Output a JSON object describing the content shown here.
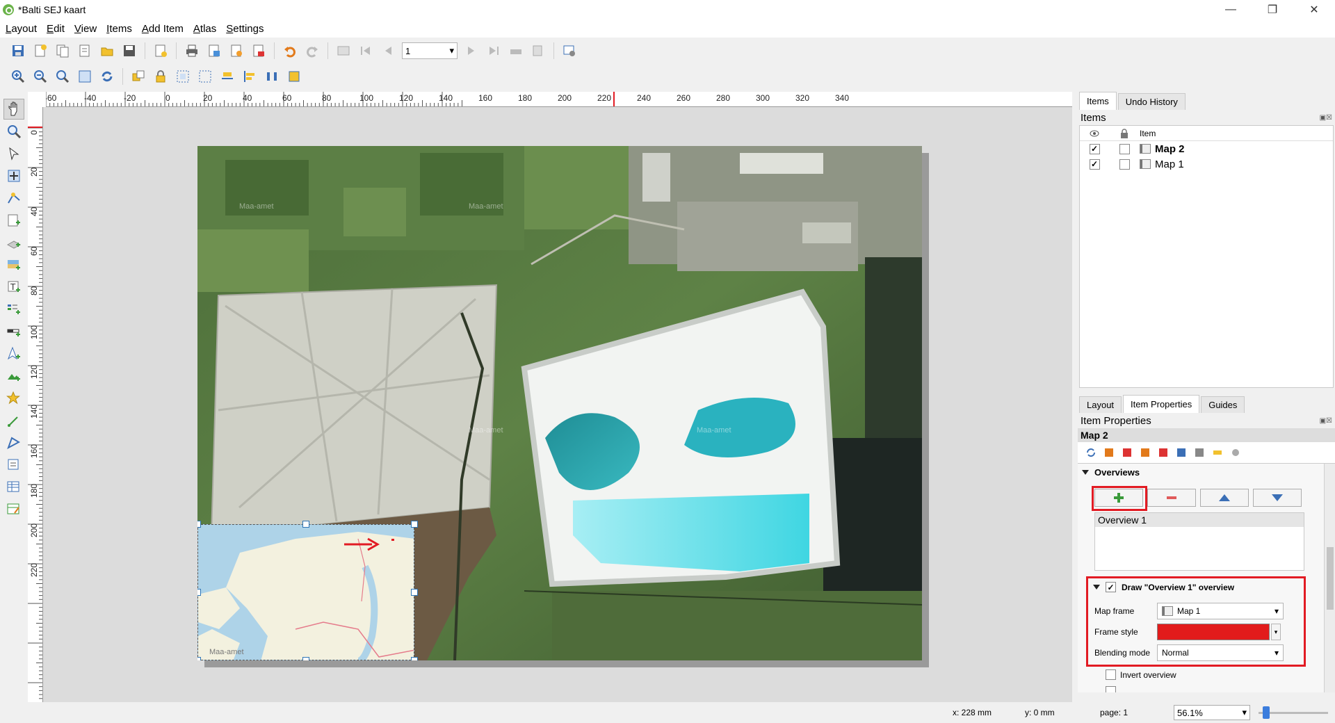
{
  "window": {
    "title": "*Balti SEJ kaart"
  },
  "menu": [
    "Layout",
    "Edit",
    "View",
    "Items",
    "Add Item",
    "Atlas",
    "Settings"
  ],
  "toolbar": {
    "page_value": "1"
  },
  "rulers": {
    "h_labels": [
      "-60",
      "-40",
      "-20",
      "0",
      "20",
      "40",
      "60",
      "80",
      "100",
      "120",
      "140",
      "160",
      "180",
      "200",
      "220",
      "240",
      "260",
      "280",
      "300",
      "320",
      "340"
    ],
    "v_labels": [
      "0",
      "20",
      "40",
      "60",
      "80",
      "100",
      "120",
      "140",
      "160",
      "180",
      "200",
      "220"
    ]
  },
  "canvas": {
    "map2_watermark": "Maa-amet",
    "map1_watermark": "Maa-amet"
  },
  "dock": {
    "top_tabs": [
      "Items",
      "Undo History"
    ],
    "items_title": "Items",
    "items_col_header": "Item",
    "items": [
      {
        "name": "Map 2",
        "visible": true,
        "locked": false,
        "selected": true
      },
      {
        "name": "Map 1",
        "visible": true,
        "locked": false,
        "selected": false
      }
    ],
    "bottom_tabs": [
      "Layout",
      "Item Properties",
      "Guides"
    ],
    "properties_title": "Item Properties",
    "item_name": "Map 2",
    "overviews_label": "Overviews",
    "overview_list": [
      "Overview 1"
    ],
    "draw_overview_label": "Draw \"Overview 1\" overview",
    "map_frame_label": "Map frame",
    "map_frame_value": "Map 1",
    "frame_style_label": "Frame style",
    "blending_mode_label": "Blending mode",
    "blending_mode_value": "Normal",
    "invert_overview_label": "Invert overview",
    "colors": {
      "frame_style": "#e21b1b",
      "highlight": "#e21b23"
    }
  },
  "status": {
    "x": "x: 228 mm",
    "y": "y: 0 mm",
    "page": "page: 1",
    "zoom": "56.1%"
  }
}
